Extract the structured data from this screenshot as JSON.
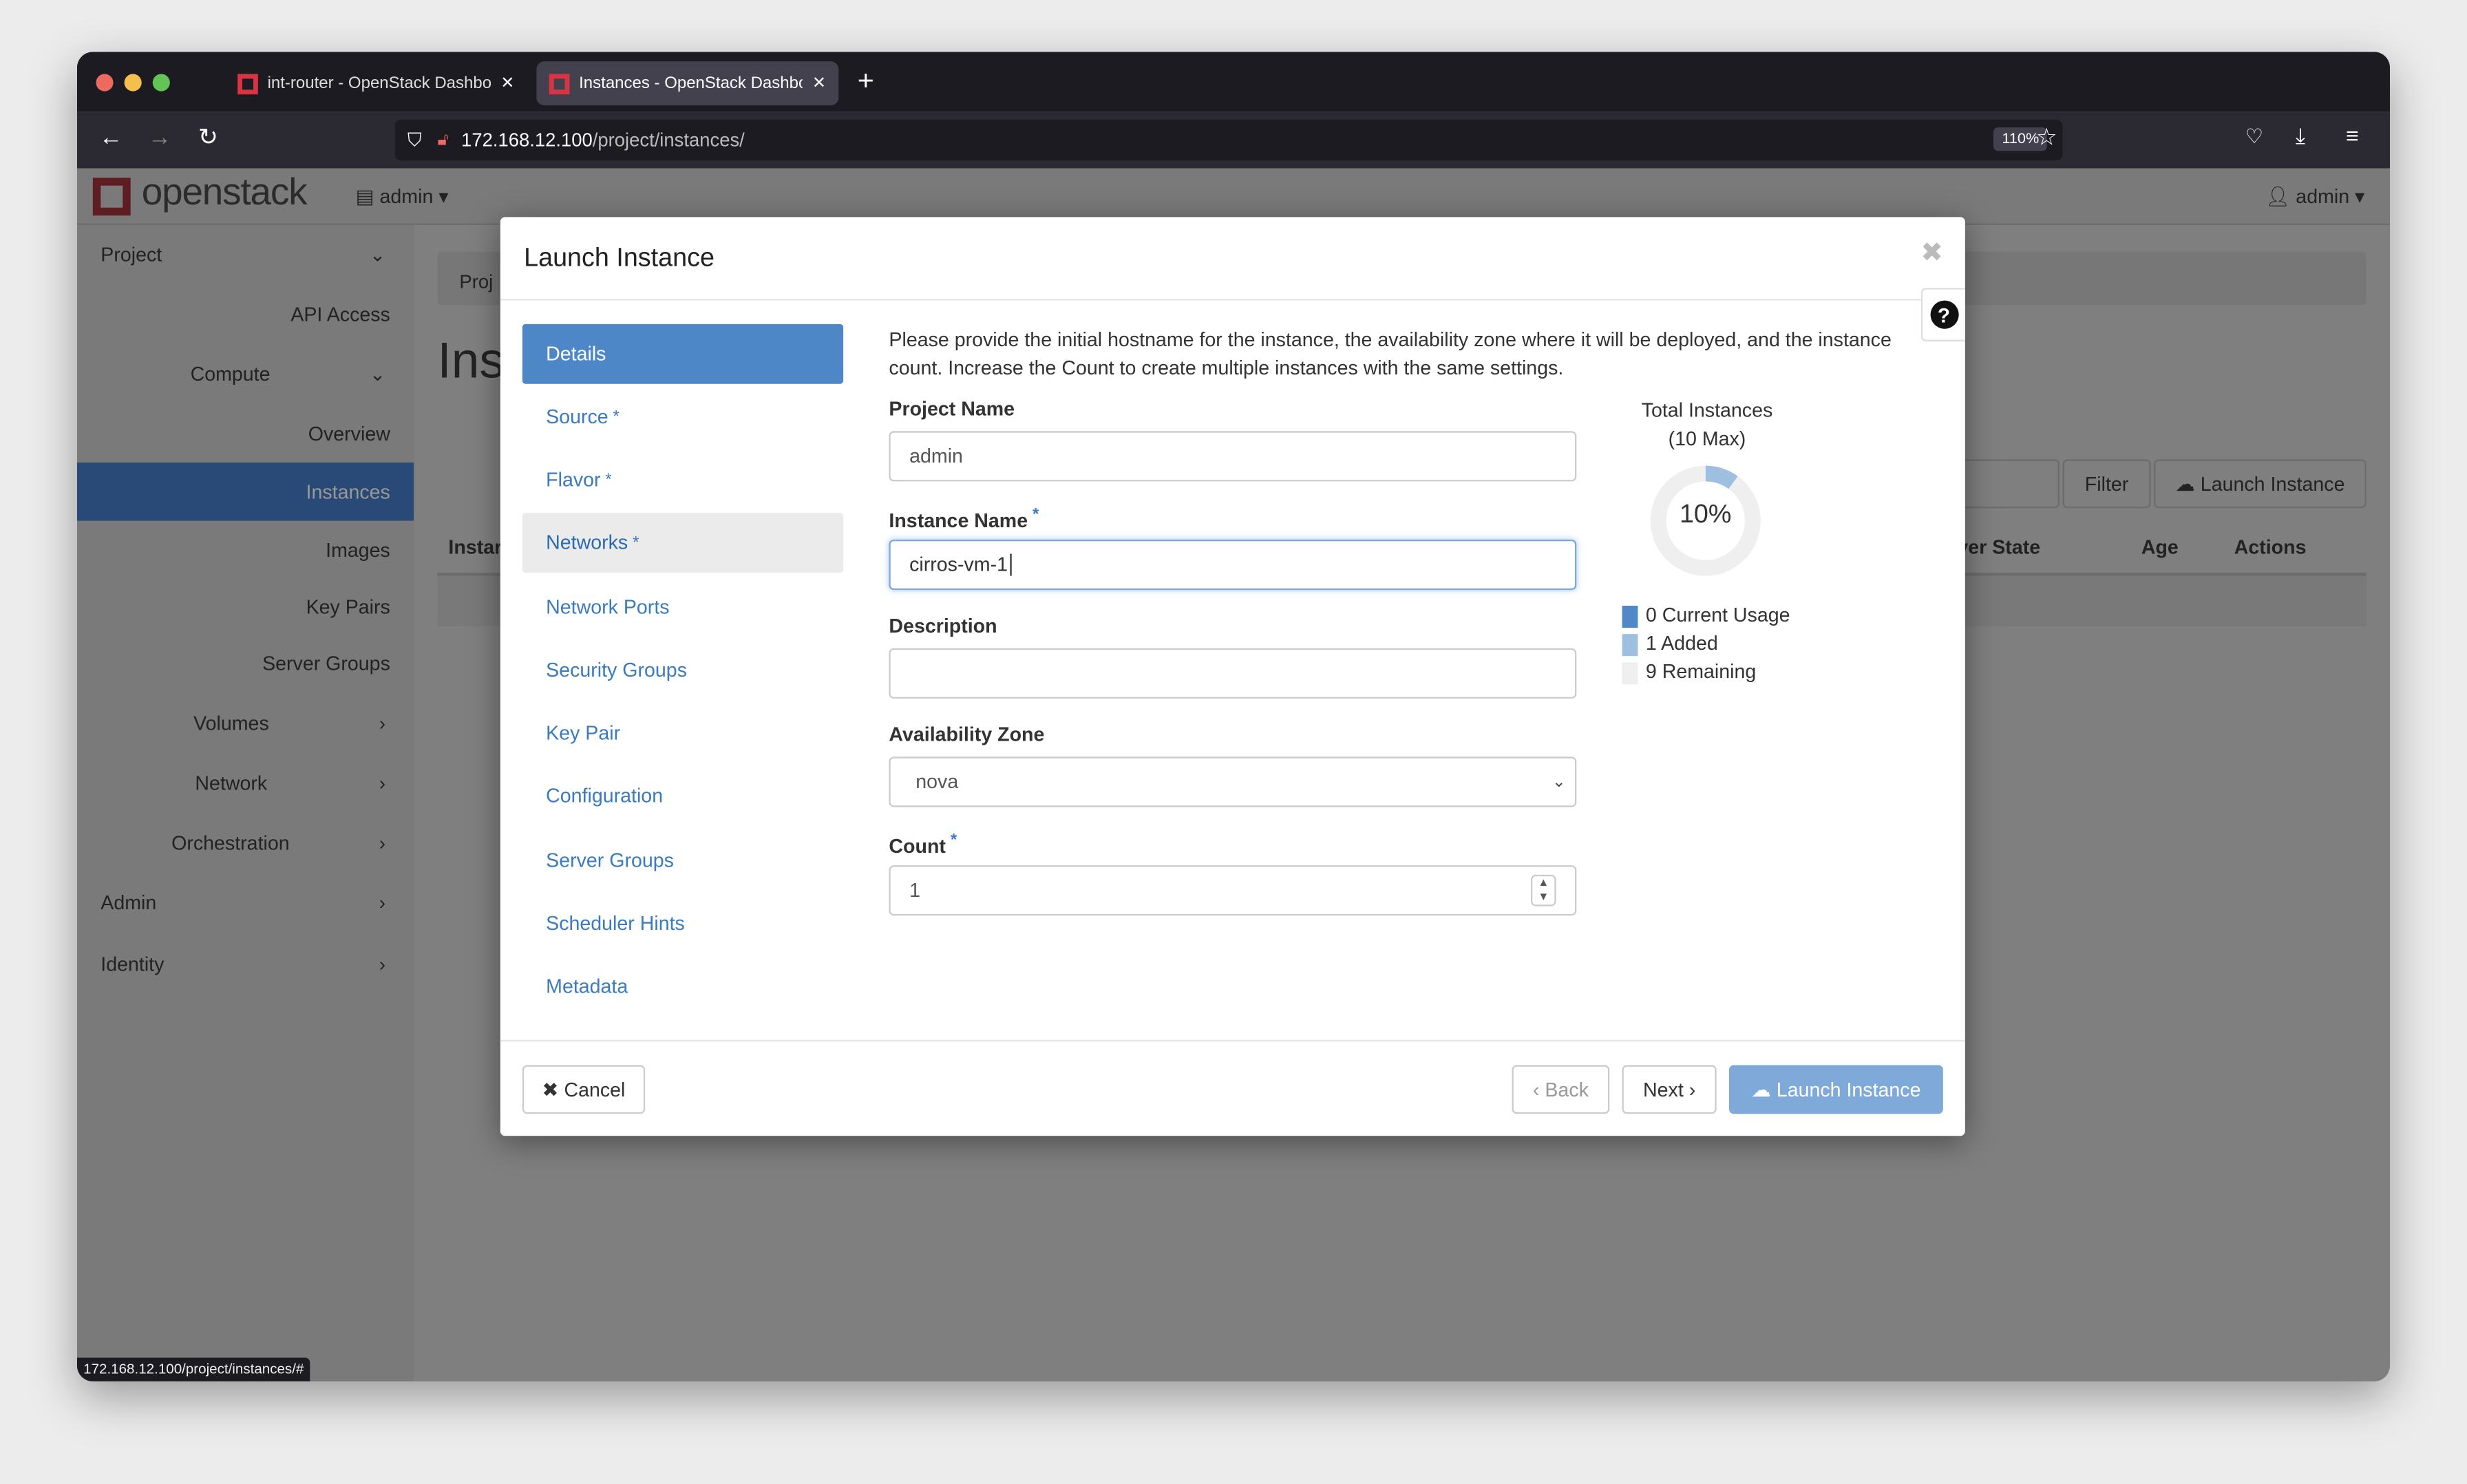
{
  "browser": {
    "tabs": [
      {
        "title": "int-router - OpenStack Dashboard",
        "active": false
      },
      {
        "title": "Instances - OpenStack Dashboard",
        "active": true
      }
    ],
    "url_host": "172.168.12.100",
    "url_path": "/project/instances/",
    "zoom": "110%",
    "status_url": "172.168.12.100/project/instances/#"
  },
  "header": {
    "logo": "openstack",
    "project": "admin",
    "user": "admin"
  },
  "sidebar": {
    "items": [
      {
        "label": "Project",
        "icon": "chevron-down"
      },
      {
        "label": "API Access"
      },
      {
        "label": "Compute",
        "icon": "chevron-down"
      },
      {
        "label": "Overview"
      },
      {
        "label": "Instances",
        "active": true
      },
      {
        "label": "Images"
      },
      {
        "label": "Key Pairs"
      },
      {
        "label": "Server Groups"
      },
      {
        "label": "Volumes",
        "icon": "chevron-right"
      },
      {
        "label": "Network",
        "icon": "chevron-right"
      },
      {
        "label": "Orchestration",
        "icon": "chevron-right"
      },
      {
        "label": "Admin",
        "icon": "chevron-right"
      },
      {
        "label": "Identity",
        "icon": "chevron-right"
      }
    ]
  },
  "background": {
    "breadcrumb": "Proj",
    "title": "Ins",
    "filter": "Filter",
    "launch": "Launch Instance",
    "col_first": "Instar",
    "col_power": "ver State",
    "col_age": "Age",
    "col_actions": "Actions"
  },
  "modal": {
    "title": "Launch Instance",
    "nav": [
      {
        "label": "Details",
        "active": true
      },
      {
        "label": "Source",
        "required": true
      },
      {
        "label": "Flavor",
        "required": true
      },
      {
        "label": "Networks",
        "required": true,
        "highlight": true
      },
      {
        "label": "Network Ports"
      },
      {
        "label": "Security Groups"
      },
      {
        "label": "Key Pair"
      },
      {
        "label": "Configuration"
      },
      {
        "label": "Server Groups"
      },
      {
        "label": "Scheduler Hints"
      },
      {
        "label": "Metadata"
      }
    ],
    "intro": "Please provide the initial hostname for the instance, the availability zone where it will be deployed, and the instance count. Increase the Count to create multiple instances with the same settings.",
    "project_name_label": "Project Name",
    "project_name": "admin",
    "instance_name_label": "Instance Name",
    "instance_name": "cirros-vm-1",
    "description_label": "Description",
    "description": "",
    "az_label": "Availability Zone",
    "az": "nova",
    "count_label": "Count",
    "count": "1",
    "required_mark": "*",
    "chart": {
      "title": "Total Instances",
      "subtitle": "(10 Max)",
      "percent_label": "10%",
      "max": 10,
      "legend": [
        {
          "value": "0",
          "label": "Current Usage",
          "color": "#5088c8"
        },
        {
          "value": "1",
          "label": "Added",
          "color": "#9ebfe0"
        },
        {
          "value": "9",
          "label": "Remaining",
          "color": "#efefef"
        }
      ]
    },
    "cancel": "Cancel",
    "back": "Back",
    "next": "Next",
    "launch": "Launch Instance"
  }
}
